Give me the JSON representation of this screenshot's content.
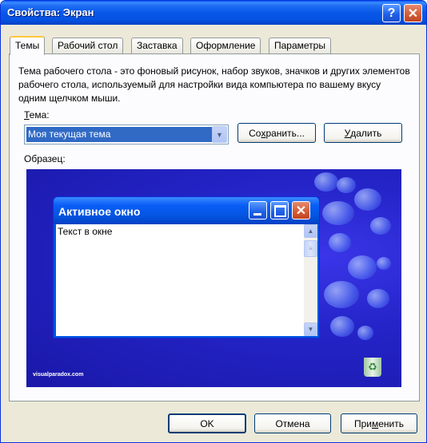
{
  "window": {
    "title": "Свойства: Экран",
    "help_label": "?",
    "close_label": "✕"
  },
  "tabs": [
    {
      "label": "Темы",
      "active": true
    },
    {
      "label": "Рабочий стол",
      "active": false
    },
    {
      "label": "Заставка",
      "active": false
    },
    {
      "label": "Оформление",
      "active": false
    },
    {
      "label": "Параметры",
      "active": false
    }
  ],
  "themes": {
    "description": "Тема рабочего стола - это фоновый рисунок, набор звуков, значков и других элементов рабочего стола, используемый для настройки вида компьютера по вашему вкусу одним щелчком мыши.",
    "theme_label_first": "Т",
    "theme_label_rest": "ема:",
    "theme_value": "Моя текущая тема",
    "save_label_a": "Со",
    "save_label_u": "х",
    "save_label_b": "ранить...",
    "delete_label_u": "У",
    "delete_label_rest": "далить",
    "preview_label": "Образец:"
  },
  "preview": {
    "window_title": "Активное окно",
    "window_text": "Текст в окне",
    "close_glyph": "✕",
    "watermark": "visualparadox.com"
  },
  "footer": {
    "ok_label": "OK",
    "cancel_label": "Отмена",
    "apply_label_a": "При",
    "apply_label_u": "м",
    "apply_label_b": "енить"
  },
  "colors": {
    "titlebar": "#0054e3",
    "selection": "#316ac5",
    "dialog_bg": "#ece9d8",
    "active_tab_accent": "#ffc83c",
    "preview_bg": "#2424c8"
  }
}
